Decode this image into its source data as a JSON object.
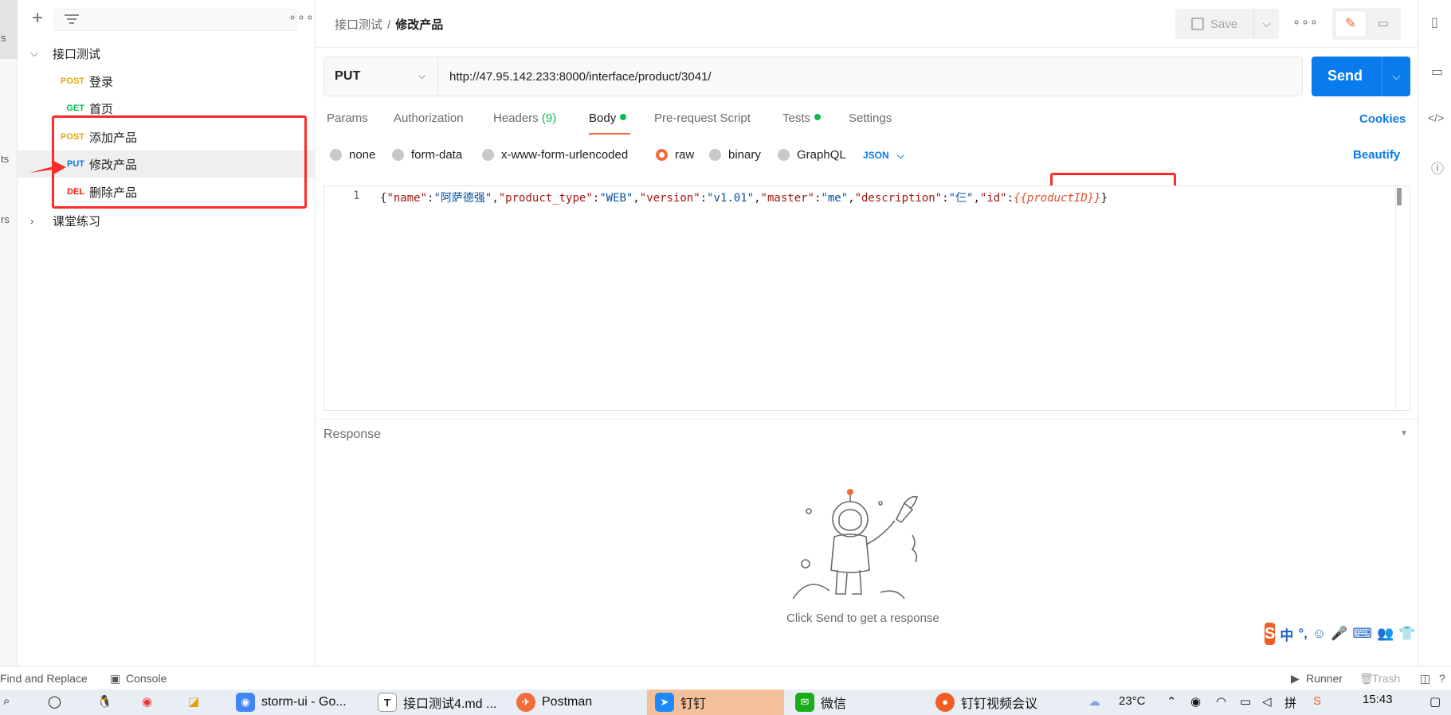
{
  "left_rail": {
    "labels": [
      "s",
      "ts",
      "rs"
    ]
  },
  "sidebar": {
    "collections": [
      {
        "name": "接口测试",
        "expanded": true,
        "requests": [
          {
            "method": "POST",
            "name": "登录"
          },
          {
            "method": "GET",
            "name": "首页"
          },
          {
            "method": "POST",
            "name": "添加产品"
          },
          {
            "method": "PUT",
            "name": "修改产品"
          },
          {
            "method": "DEL",
            "name": "删除产品"
          }
        ]
      },
      {
        "name": "课堂练习",
        "expanded": false
      }
    ]
  },
  "header": {
    "breadcrumb": [
      "接口测试",
      "修改产品"
    ],
    "breadcrumb_sep": "/",
    "save_label": "Save",
    "more": "ooo"
  },
  "request": {
    "method": "PUT",
    "url": "http://47.95.142.233:8000/interface/product/3041/",
    "send_label": "Send"
  },
  "tabs": {
    "params": "Params",
    "authorization": "Authorization",
    "headers": "Headers",
    "headers_count": "(9)",
    "body": "Body",
    "prerequest": "Pre-request Script",
    "tests": "Tests",
    "settings": "Settings",
    "cookies": "Cookies",
    "active": "Body"
  },
  "body_types": {
    "options": [
      "none",
      "form-data",
      "x-www-form-urlencoded",
      "raw",
      "binary",
      "GraphQL"
    ],
    "selected": "raw",
    "format": "JSON",
    "beautify": "Beautify"
  },
  "editor": {
    "line_number": "1",
    "t_open": "{",
    "k_name": "\"name\"",
    "v_name": "\"阿萨德强\"",
    "k_type": "\"product_type\"",
    "v_type": "\"WEB\"",
    "k_version": "\"version\"",
    "v_version": "\"v1.01\"",
    "k_master": "\"master\"",
    "v_master": "\"me\"",
    "k_desc": "\"description\"",
    "v_desc": "\"仨\"",
    "k_id": "\"id\"",
    "v_id": "{{productID}}",
    "t_close": "}",
    "colon": ":",
    "comma": ","
  },
  "response": {
    "title": "Response",
    "empty_hint": "Click Send to get a response"
  },
  "ime_toolbar": {
    "logo": "S",
    "items": [
      "中",
      "°,",
      "☺",
      "🎤",
      "⌨",
      "👥",
      "👕",
      "⚙"
    ]
  },
  "statusbar": {
    "find_replace": "Find and Replace",
    "console": "Console",
    "runner": "Runner",
    "trash": "Trash"
  },
  "taskbar": {
    "apps": [
      {
        "label": "storm-ui - Go...",
        "icon": "chrome"
      },
      {
        "label": "接口测试4.md ...",
        "icon": "typora"
      },
      {
        "label": "Postman",
        "icon": "postman"
      },
      {
        "label": "钉钉",
        "icon": "dingtalk"
      },
      {
        "label": "微信",
        "icon": "wechat"
      },
      {
        "label": "钉钉视频会议",
        "icon": "dingtalk-meeting"
      }
    ],
    "temperature": "23°C",
    "time": "15:43"
  },
  "colors": {
    "accent_orange": "#f26b3a",
    "send_blue": "#097bed",
    "post": "#e6a800",
    "get": "#0cbb52",
    "put": "#097bed",
    "del": "#eb2013",
    "annotation_red": "#ff2b2b"
  }
}
